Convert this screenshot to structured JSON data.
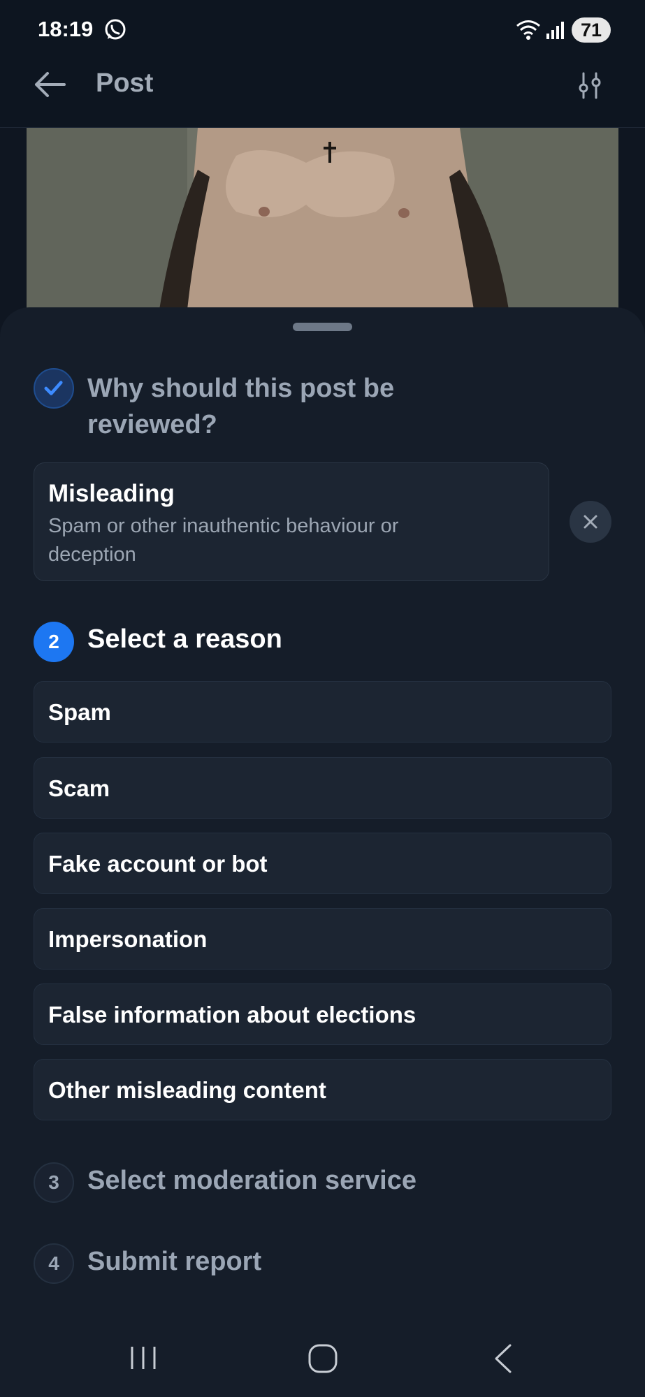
{
  "status_bar": {
    "time": "18:19",
    "battery": "71",
    "icons": [
      "whatsapp-icon",
      "wifi-icon",
      "signal-icon"
    ]
  },
  "header": {
    "title": "Post",
    "back_icon": "arrow-left-icon",
    "filter_icon": "sliders-icon"
  },
  "report": {
    "step1": {
      "title": "Why should this post be reviewed?",
      "selected_title": "Misleading",
      "selected_description": "Spam or other inauthentic behaviour or deception"
    },
    "step2": {
      "number": "2",
      "title": "Select a reason",
      "reasons": [
        "Spam",
        "Scam",
        "Fake account or bot",
        "Impersonation",
        "False information about elections",
        "Other misleading content"
      ]
    },
    "step3": {
      "number": "3",
      "title": "Select moderation service"
    },
    "step4": {
      "number": "4",
      "title": "Submit report"
    }
  },
  "colors": {
    "accent": "#1d77f2",
    "background": "#151d29",
    "card": "#1c2532"
  }
}
